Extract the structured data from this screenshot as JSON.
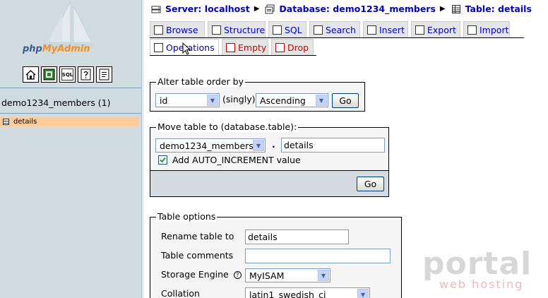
{
  "app": {
    "logo_part1": "php",
    "logo_part2": "MyAdmin"
  },
  "left": {
    "icons": [
      "home-icon",
      "exit-icon",
      "sql-query-icon",
      "help-icon",
      "documentation-icon"
    ],
    "icon_labels": [
      "",
      "",
      "SQL",
      "",
      ""
    ],
    "database": "demo1234_members (1)",
    "tables": [
      {
        "name": "details"
      }
    ]
  },
  "breadcrumb": {
    "server": "Server: localhost",
    "database": "Database: demo1234_members",
    "table": "Table: details"
  },
  "tabs": {
    "row1": [
      {
        "label": "Browse"
      },
      {
        "label": "Structure"
      },
      {
        "label": "SQL"
      },
      {
        "label": "Search"
      },
      {
        "label": "Insert"
      },
      {
        "label": "Export"
      },
      {
        "label": "Import"
      }
    ],
    "row2": [
      {
        "label": "Operations"
      },
      {
        "label": "Empty"
      },
      {
        "label": "Drop"
      }
    ]
  },
  "alter_order": {
    "legend": "Alter table order by",
    "column": "id",
    "singly": "(singly)",
    "direction": "Ascending",
    "go": "Go"
  },
  "move_table": {
    "legend": "Move table to (database.table):",
    "database": "demo1234_members",
    "dot": ".",
    "table_name": "details",
    "auto_increment_label": "Add AUTO_INCREMENT value",
    "auto_increment_checked": true,
    "go": "Go"
  },
  "table_options": {
    "legend": "Table options",
    "rename_label": "Rename table to",
    "rename_value": "details",
    "comments_label": "Table comments",
    "comments_value": "",
    "engine_label": "Storage Engine",
    "engine_value": "MyISAM",
    "collation_label": "Collation",
    "collation_value": "latin1_swedish_ci"
  },
  "watermark": {
    "brand": "portal",
    "sub": "web hosting"
  },
  "colors": {
    "left_bg": "#d0dce0",
    "link_blue": "#0000cc",
    "danger_red": "#cc0000",
    "selected_table_bg": "#ffcc99"
  }
}
